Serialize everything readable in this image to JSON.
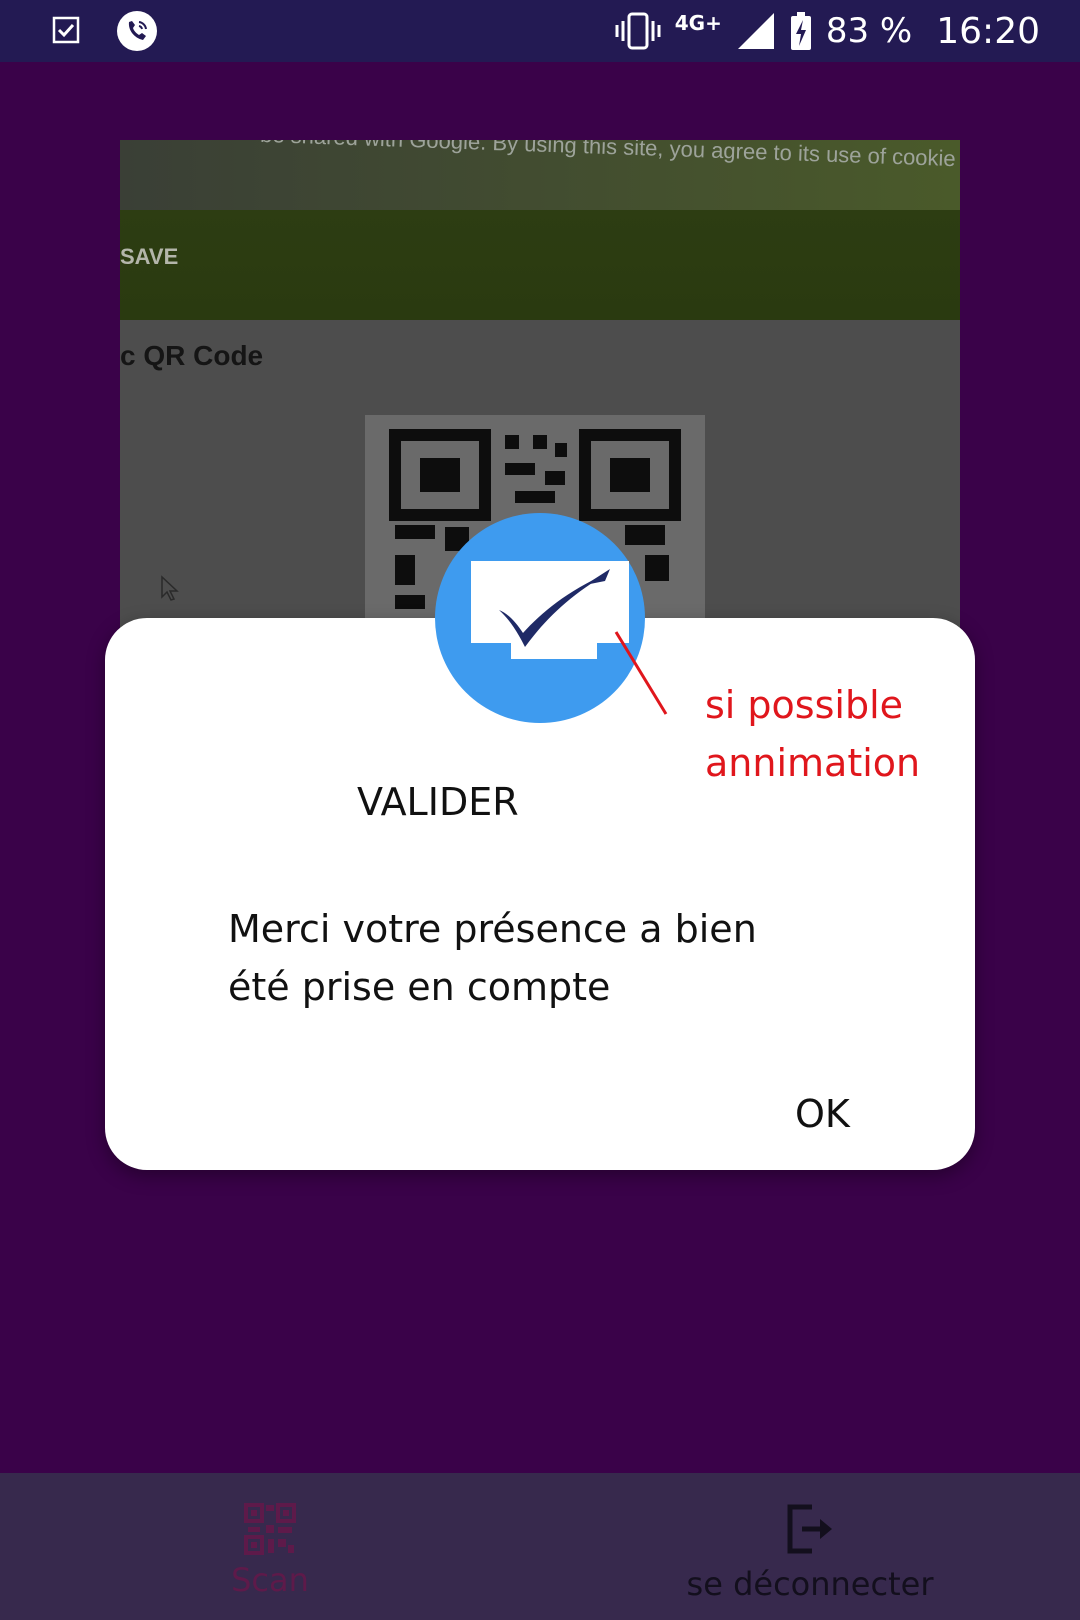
{
  "status_bar": {
    "battery": "83 %",
    "time": "16:20",
    "network": "4G+"
  },
  "camera_preview": {
    "top_text": "be shared with Google. By using this site, you agree to its use of cookie",
    "save_text": "SAVE",
    "qr_title": "c QR Code"
  },
  "dialog": {
    "title": "VALIDER",
    "message_line1": "Merci votre présence a bien",
    "message_line2": "été prise en compte",
    "ok_label": "OK"
  },
  "annotation": {
    "line1": "si possible",
    "line2": "annimation",
    "color": "#e0161c"
  },
  "bottom_nav": {
    "items": [
      {
        "label": "Scan",
        "icon": "qr-code-icon"
      },
      {
        "label": "se déconnecter",
        "icon": "logout-icon"
      }
    ]
  },
  "colors": {
    "status_bar": "#231a53",
    "background": "#3a0249",
    "badge": "#3e9bef",
    "nav": "#37294d"
  }
}
